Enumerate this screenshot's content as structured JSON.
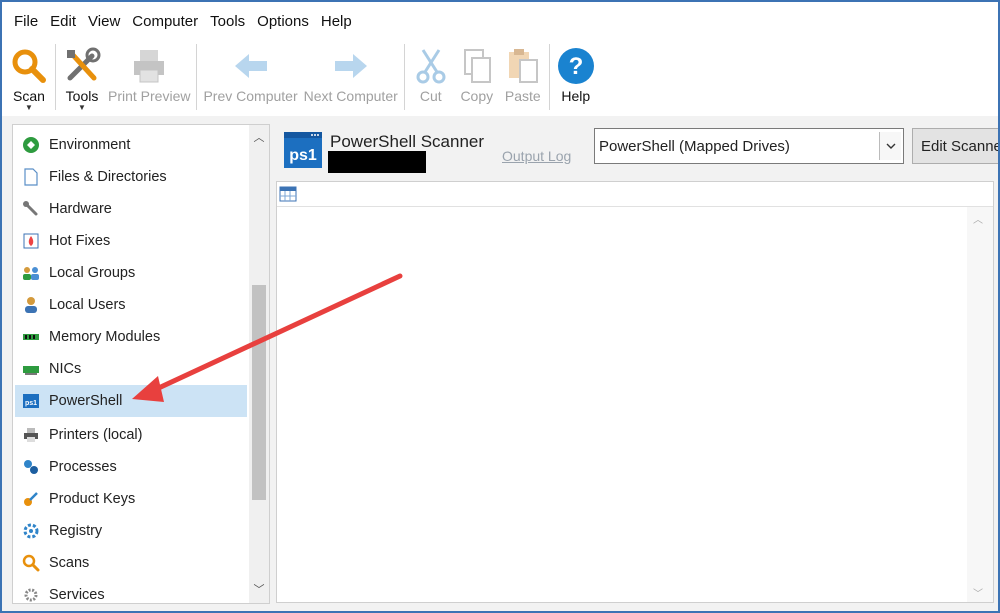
{
  "menu": [
    "File",
    "Edit",
    "View",
    "Computer",
    "Tools",
    "Options",
    "Help"
  ],
  "toolbar": {
    "scan_label": "Scan",
    "tools_label": "Tools",
    "print_preview_label": "Print Preview",
    "prev_computer_label": "Prev Computer",
    "next_computer_label": "Next Computer",
    "cut_label": "Cut",
    "copy_label": "Copy",
    "paste_label": "Paste",
    "help_label": "Help",
    "dropdown_glyph": "▼"
  },
  "tree": {
    "items": [
      {
        "label": "Environment",
        "icon": "environment-icon"
      },
      {
        "label": "Files & Directories",
        "icon": "file-icon"
      },
      {
        "label": "Hardware",
        "icon": "wrench-icon"
      },
      {
        "label": "Hot Fixes",
        "icon": "hotfix-icon"
      },
      {
        "label": "Local Groups",
        "icon": "group-icon"
      },
      {
        "label": "Local Users",
        "icon": "user-icon"
      },
      {
        "label": "Memory Modules",
        "icon": "memory-icon"
      },
      {
        "label": "NICs",
        "icon": "nic-icon"
      },
      {
        "label": "PowerShell",
        "icon": "powershell-icon"
      },
      {
        "label": "Printers (local)",
        "icon": "printer-icon"
      },
      {
        "label": "Processes",
        "icon": "processes-icon"
      },
      {
        "label": "Product Keys",
        "icon": "key-icon"
      },
      {
        "label": "Registry",
        "icon": "registry-icon"
      },
      {
        "label": "Scans",
        "icon": "search-icon"
      },
      {
        "label": "Services",
        "icon": "gear-icon"
      }
    ],
    "selected": "PowerShell"
  },
  "scanner": {
    "title": "PowerShell Scanner",
    "output_log_label": "Output Log",
    "selected_scanner": "PowerShell (Mapped Drives)",
    "edit_button_label": "Edit Scanne",
    "ps_badge": "ps1"
  },
  "colors": {
    "accent": "#3c73b4",
    "selection": "#cce3f5",
    "arrow": "#e8403e"
  }
}
